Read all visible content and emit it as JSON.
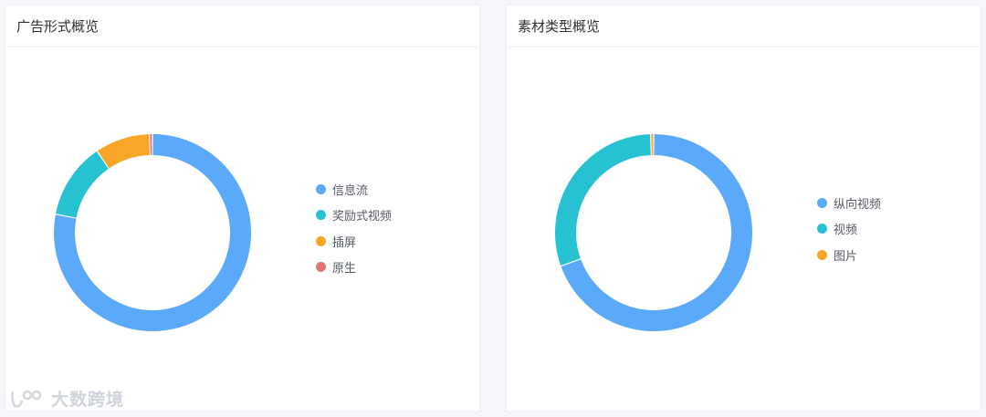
{
  "chart_data": [
    {
      "type": "pie",
      "donut": true,
      "title": "广告形式概览",
      "legend_position": "right",
      "slices": [
        {
          "label": "信息流",
          "value": 78,
          "color": "#5aa9fa"
        },
        {
          "label": "奖励式视频",
          "value": 12.5,
          "color": "#27c2d2"
        },
        {
          "label": "插屏",
          "value": 9,
          "color": "#f8a628"
        },
        {
          "label": "原生",
          "value": 0.5,
          "color": "#e27676"
        }
      ]
    },
    {
      "type": "pie",
      "donut": true,
      "title": "素材类型概览",
      "legend_position": "right",
      "slices": [
        {
          "label": "纵向视频",
          "value": 69.5,
          "color": "#5aa9fa"
        },
        {
          "label": "视频",
          "value": 30,
          "color": "#27c2d2"
        },
        {
          "label": "图片",
          "value": 0.5,
          "color": "#f8a628"
        }
      ]
    }
  ],
  "watermark": {
    "text": "大数跨境"
  }
}
